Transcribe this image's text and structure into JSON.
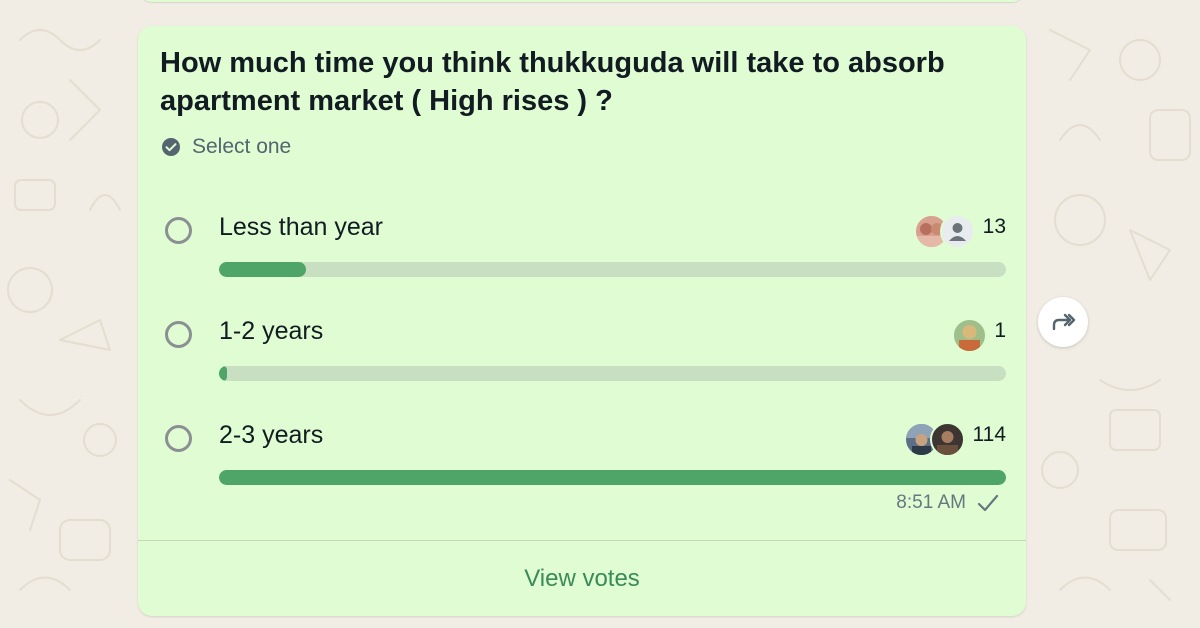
{
  "poll": {
    "question": "How much time you think thukkuguda will take to absorb apartment market ( High rises ) ?",
    "select_hint": "Select one",
    "options": [
      {
        "label": "Less than year",
        "votes": "13",
        "progress": 0.11,
        "voter_avatars": [
          "photo-avatar",
          "default-person-avatar"
        ]
      },
      {
        "label": "1-2 years",
        "votes": "1",
        "progress": 0.01,
        "voter_avatars": [
          "photo-avatar"
        ]
      },
      {
        "label": "2-3 years",
        "votes": "114",
        "progress": 1.0,
        "voter_avatars": [
          "photo-avatar",
          "photo-avatar"
        ]
      }
    ],
    "time": "8:51 AM",
    "status_icon": "single-check-icon",
    "view_votes_label": "View votes"
  },
  "forward_icon": "forward-icon",
  "colors": {
    "bubble": "#dffcd2",
    "bar_fill": "#4fa468",
    "bar_track": "#c9dfc1",
    "link": "#3b8a5a",
    "wallpaper": "#f1ede4"
  }
}
